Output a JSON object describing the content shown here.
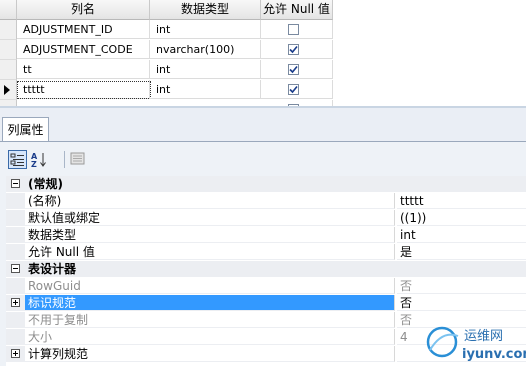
{
  "grid": {
    "headers": {
      "name": "列名",
      "type": "数据类型",
      "nullable": "允许 Null 值"
    },
    "rows": [
      {
        "name": "ADJUSTMENT_ID",
        "type": "int",
        "allow_null": false
      },
      {
        "name": "ADJUSTMENT_CODE",
        "type": "nvarchar(100)",
        "allow_null": true
      },
      {
        "name": "tt",
        "type": "int",
        "allow_null": true
      },
      {
        "name": "ttttt",
        "type": "int",
        "allow_null": true
      }
    ]
  },
  "tab": {
    "label": "列属性"
  },
  "toolbar": {
    "categorized_icon": "categorized-icon",
    "alphabetical_icon": "alphabetical-icon",
    "property_pages_icon": "property-pages-icon"
  },
  "props": {
    "cat_general": "(常规)",
    "name_key": "(名称)",
    "name_val": "ttttt",
    "default_key": "默认值或绑定",
    "default_val": "((1))",
    "type_key": "数据类型",
    "type_val": "int",
    "null_key": "允许 Null 值",
    "null_val": "是",
    "cat_designer": "表设计器",
    "rowguid_key": "RowGuid",
    "rowguid_val": "否",
    "identity_key": "标识规范",
    "identity_val": "否",
    "repl_key": "不用于复制",
    "repl_val": "否",
    "size_key": "大小",
    "size_val": "4",
    "computed_key": "计算列规范"
  },
  "watermark": {
    "cn": "运维网",
    "url": "iyunv.com"
  },
  "colors": {
    "selection": "#3399ff",
    "category_bg": "#eceef2",
    "tab_border": "#9aa8bc"
  }
}
